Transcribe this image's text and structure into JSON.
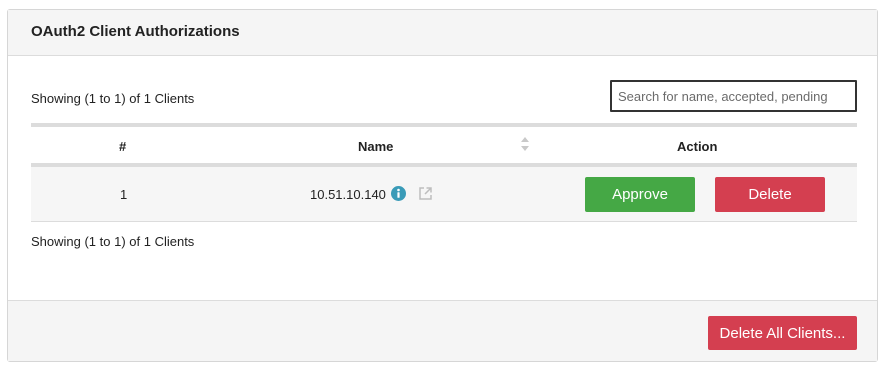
{
  "panel": {
    "title": "OAuth2 Client Authorizations"
  },
  "summary": {
    "top": "Showing (1 to 1) of 1 Clients",
    "bottom": "Showing (1 to 1) of 1 Clients"
  },
  "search": {
    "placeholder": "Search for name, accepted, pending",
    "value": ""
  },
  "table": {
    "columns": [
      "#",
      "Name",
      "Action"
    ],
    "rows": [
      {
        "num": "1",
        "name": "10.51.10.140",
        "approve_label": "Approve",
        "delete_label": "Delete"
      }
    ]
  },
  "icons": {
    "sort": "sort-icon",
    "info": "info-icon",
    "external": "external-link-icon"
  },
  "colors": {
    "approve": "#45a845",
    "delete": "#d43f50",
    "info": "#3a9bb8"
  },
  "footer": {
    "delete_all_label": "Delete All Clients..."
  }
}
